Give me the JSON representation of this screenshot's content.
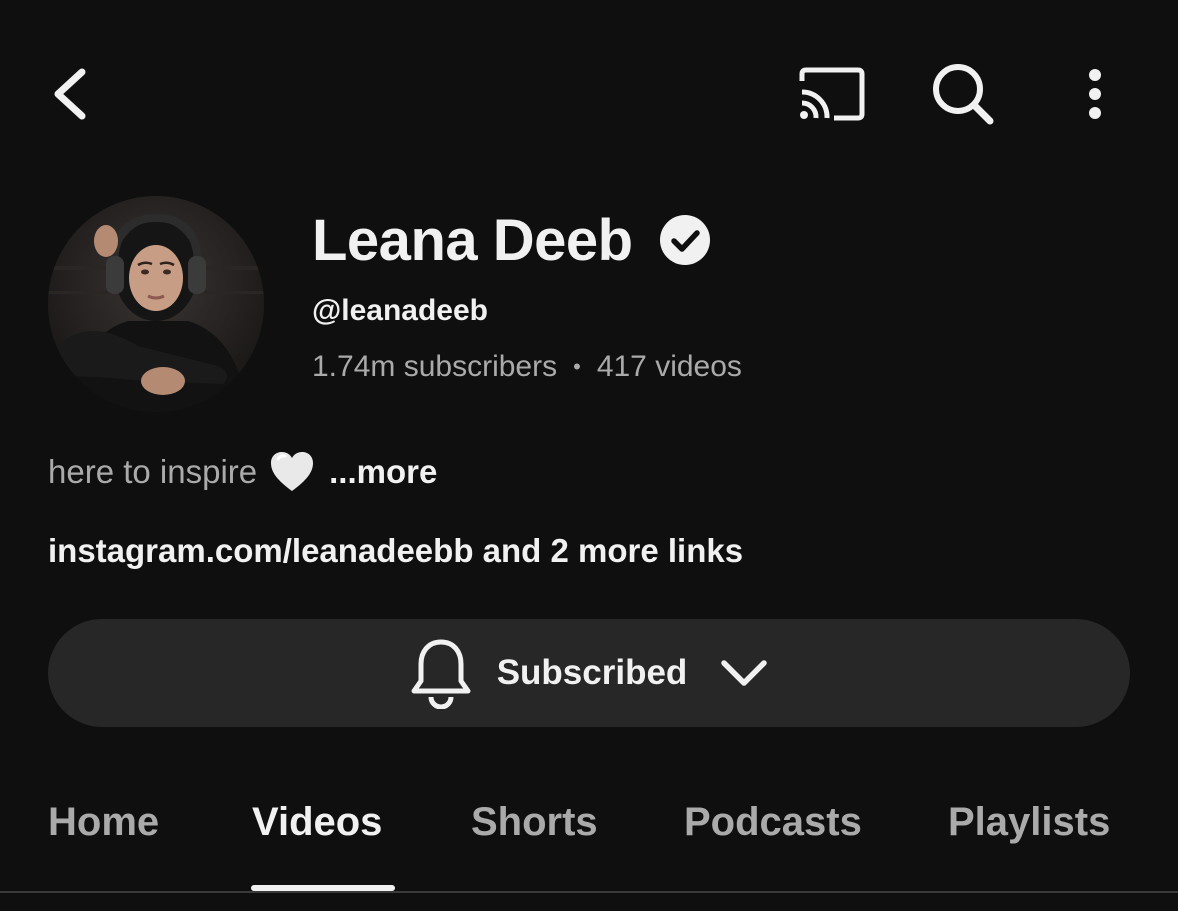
{
  "header": {
    "back_icon": "chevron-left-icon",
    "cast_icon": "cast-icon",
    "search_icon": "search-icon",
    "more_icon": "more-vertical-icon"
  },
  "channel": {
    "name": "Leana Deeb",
    "verified": true,
    "handle": "@leanadeeb",
    "subscribers": "1.74m subscribers",
    "separator": "•",
    "videos": "417 videos",
    "description": "here to inspire",
    "description_emoji": "white-heart-icon",
    "more_label": "...more",
    "links": "instagram.com/leanadeebb and 2 more links"
  },
  "subscribe": {
    "label": "Subscribed",
    "bell_icon": "bell-icon",
    "chevron_icon": "chevron-down-icon"
  },
  "tabs": [
    {
      "label": "Home",
      "active": false
    },
    {
      "label": "Videos",
      "active": true
    },
    {
      "label": "Shorts",
      "active": false
    },
    {
      "label": "Podcasts",
      "active": false
    },
    {
      "label": "Playlists",
      "active": false
    }
  ],
  "colors": {
    "background": "#0f0f0f",
    "text_primary": "#f1f1f1",
    "text_secondary": "#aaaaaa",
    "button_bg": "#272727"
  }
}
